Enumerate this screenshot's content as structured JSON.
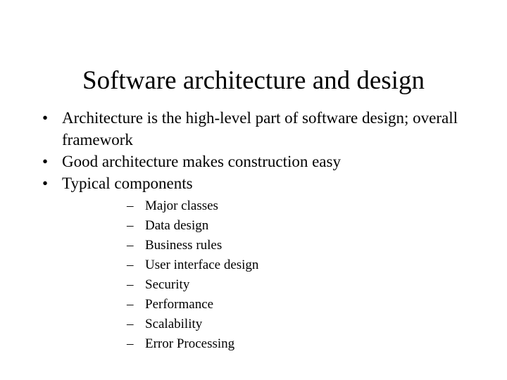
{
  "slide": {
    "title": "Software architecture and design",
    "background_color": "#ffffff",
    "text_color": "#000000",
    "bullet_marker": "•",
    "sub_bullet_marker": "–",
    "bullets": [
      {
        "text": "Architecture is the high-level part of software design; overall framework"
      },
      {
        "text": "Good architecture makes construction easy"
      },
      {
        "text": "Typical components"
      }
    ],
    "sub_bullets": [
      {
        "text": "Major classes"
      },
      {
        "text": "Data design"
      },
      {
        "text": "Business rules"
      },
      {
        "text": "User interface design"
      },
      {
        "text": "Security"
      },
      {
        "text": "Performance"
      },
      {
        "text": "Scalability"
      },
      {
        "text": "Error Processing"
      }
    ]
  }
}
